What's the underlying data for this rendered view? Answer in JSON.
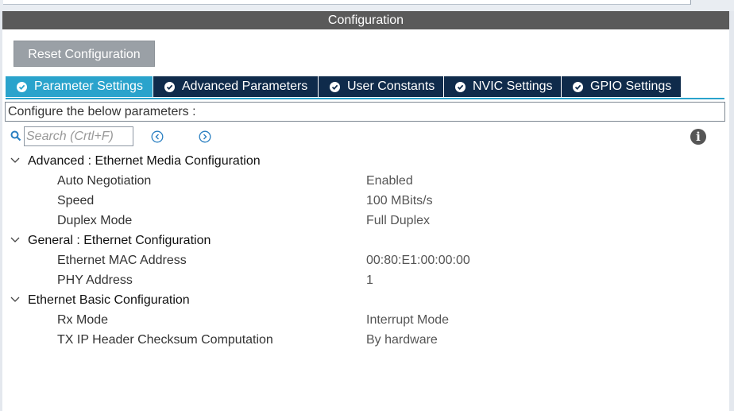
{
  "header": {
    "title": "Configuration"
  },
  "toolbar": {
    "reset_label": "Reset Configuration"
  },
  "tabs": [
    {
      "label": "Parameter Settings",
      "active": true
    },
    {
      "label": "Advanced Parameters",
      "active": false
    },
    {
      "label": "User Constants",
      "active": false
    },
    {
      "label": "NVIC Settings",
      "active": false
    },
    {
      "label": "GPIO Settings",
      "active": false
    }
  ],
  "description": "Configure the below parameters :",
  "search": {
    "placeholder": "Search (Crtl+F)",
    "value": ""
  },
  "groups": [
    {
      "title": "Advanced : Ethernet Media Configuration",
      "params": [
        {
          "name": "Auto Negotiation",
          "value": "Enabled"
        },
        {
          "name": "Speed",
          "value": "100 MBits/s"
        },
        {
          "name": "Duplex Mode",
          "value": "Full Duplex"
        }
      ]
    },
    {
      "title": "General : Ethernet Configuration",
      "params": [
        {
          "name": "Ethernet MAC Address",
          "value": "00:80:E1:00:00:00"
        },
        {
          "name": "PHY Address",
          "value": "1"
        }
      ]
    },
    {
      "title": "Ethernet Basic Configuration",
      "params": [
        {
          "name": "Rx Mode",
          "value": "Interrupt Mode"
        },
        {
          "name": "TX IP Header Checksum Computation",
          "value": "By hardware"
        }
      ]
    }
  ],
  "colors": {
    "header_bg": "#5a5a5a",
    "tab_bg": "#0f2b4b",
    "tab_active_bg": "#2aa3cc",
    "reset_button_bg": "#9aa0a6"
  },
  "icons": {
    "tab_status": "check-circle-icon",
    "search": "search-icon",
    "prev": "chevron-left-circle-icon",
    "next": "chevron-right-circle-icon",
    "info": "info-icon",
    "group_toggle": "chevron-down-icon"
  }
}
